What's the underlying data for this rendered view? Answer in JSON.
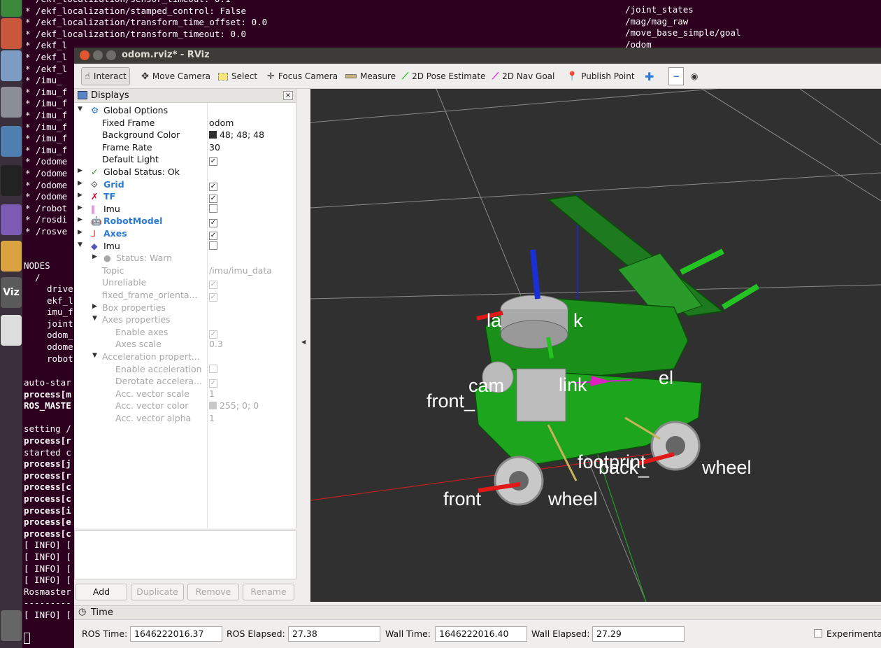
{
  "terminal": {
    "left_lines": [
      "* /ekf_localization/sensor_timeout: 0.1",
      "* /ekf_localization/stamped_control: False",
      "* /ekf_localization/transform_time_offset: 0.0",
      "* /ekf_localization/transform_timeout: 0.0",
      "* /ekf_l",
      "* /ekf_l",
      "* /ekf_l",
      "* /imu_",
      "* /imu_f",
      "* /imu_f",
      "* /imu_f",
      "* /imu_f",
      "* /imu_f",
      "* /imu_f",
      "* /odome",
      "* /odome",
      "* /odome",
      "* /odome",
      "* /robot",
      "* /rosdi",
      "* /rosve"
    ],
    "nodes_header": "NODES",
    "nodes_root": "/",
    "nodes": [
      "drive",
      "ekf_l",
      "imu_f",
      "joint",
      "odom_",
      "odome",
      "robot"
    ],
    "log_lines": [
      "auto-star",
      "process[m",
      "ROS_MASTE",
      "",
      "setting /",
      "process[r",
      "started c",
      "process[j",
      "process[r",
      "process[c",
      "process[c",
      "process[i",
      "process[e",
      "process[c",
      "[ INFO] [",
      "[ INFO] [",
      "[ INFO] [",
      "[ INFO] [",
      "Rosmaster",
      "---------",
      "[ INFO] ["
    ],
    "right_lines": [
      "/joint_states",
      "/mag/mag_raw",
      "/move_base_simple/goal",
      "/odom"
    ]
  },
  "window": {
    "title": "odom.rviz* - RViz"
  },
  "toolbar": {
    "interact": "Interact",
    "move_camera": "Move Camera",
    "select": "Select",
    "focus_camera": "Focus Camera",
    "measure": "Measure",
    "pose_estimate": "2D Pose Estimate",
    "nav_goal": "2D Nav Goal",
    "publish_point": "Publish Point"
  },
  "displays": {
    "title": "Displays",
    "global_options": "Global Options",
    "fixed_frame_label": "Fixed Frame",
    "fixed_frame": "odom",
    "background_color_label": "Background Color",
    "background_color": "48; 48; 48",
    "frame_rate_label": "Frame Rate",
    "frame_rate": "30",
    "default_light_label": "Default Light",
    "global_status": "Global Status: Ok",
    "grid": "Grid",
    "tf": "TF",
    "imu1": "Imu",
    "robot_model": "RobotModel",
    "axes": "Axes",
    "imu2": "Imu",
    "status_warn": "Status: Warn",
    "topic_label": "Topic",
    "topic": "/imu/imu_data",
    "unreliable": "Unreliable",
    "fixed_frame_orient": "fixed_frame_orienta...",
    "box_properties": "Box properties",
    "axes_properties": "Axes properties",
    "enable_axes": "Enable axes",
    "axes_scale_label": "Axes scale",
    "axes_scale": "0.3",
    "accel_properties": "Acceleration propert...",
    "enable_accel": "Enable acceleration",
    "derotate_accel": "Derotate accelera...",
    "acc_scale_label": "Acc. vector scale",
    "acc_scale": "1",
    "acc_color_label": "Acc. vector color",
    "acc_color": "255; 0; 0",
    "acc_alpha_label": "Acc. vector alpha",
    "acc_alpha": "1"
  },
  "buttons": {
    "add": "Add",
    "duplicate": "Duplicate",
    "remove": "Remove",
    "rename": "Rename"
  },
  "scene_labels": {
    "front": "front_",
    "cam": "cam",
    "link": "link",
    "el": "el",
    "la": "la",
    "k": "k",
    "footprint": "footprint",
    "back_wheel": "back_",
    "wheel": "wheel",
    "front_wheel": "front",
    "wheel2": "wheel"
  },
  "time": {
    "title": "Time",
    "ros_time_label": "ROS Time:",
    "ros_time": "1646222016.37",
    "ros_elapsed_label": "ROS Elapsed:",
    "ros_elapsed": "27.38",
    "wall_time_label": "Wall Time:",
    "wall_time": "1646222016.40",
    "wall_elapsed_label": "Wall Elapsed:",
    "wall_elapsed": "27.29",
    "experimental": "Experimenta"
  },
  "colors": {
    "viewport_bg": "#303030",
    "robot_green": "#1fa01f",
    "accent_blue": "#2a7ad4"
  }
}
